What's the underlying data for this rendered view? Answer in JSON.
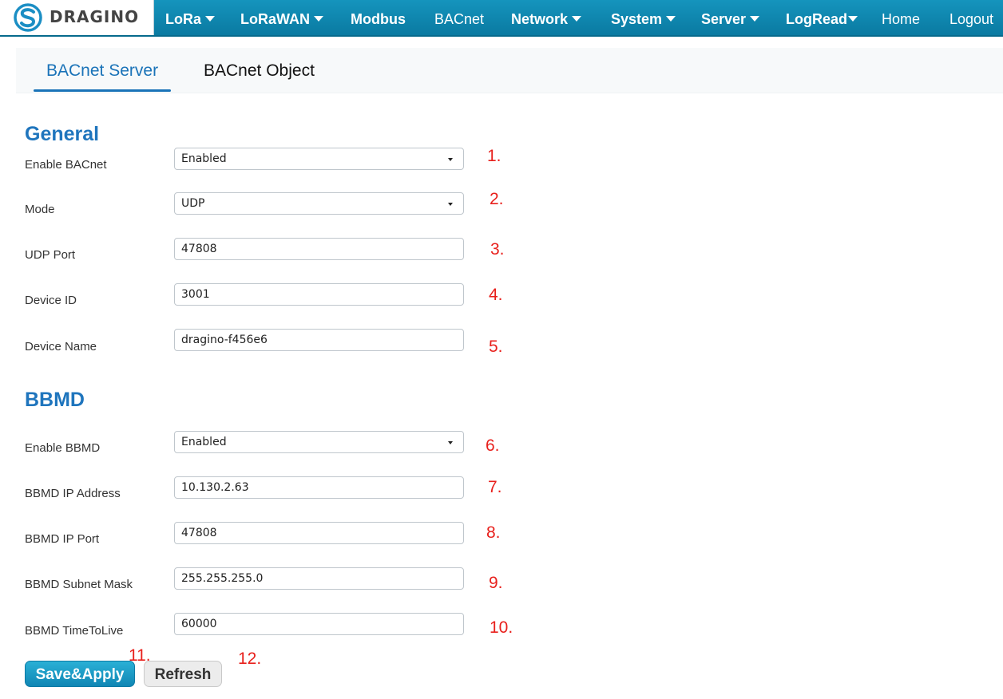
{
  "nav": {
    "logo_text": "DRAGINO",
    "items": [
      {
        "label": "LoRa",
        "dropdown": true
      },
      {
        "label": "LoRaWAN",
        "dropdown": true
      },
      {
        "label": "Modbus",
        "dropdown": false
      },
      {
        "label": "BACnet",
        "dropdown": false
      },
      {
        "label": "Network",
        "dropdown": true
      },
      {
        "label": "System",
        "dropdown": true
      },
      {
        "label": "Server",
        "dropdown": true
      },
      {
        "label": "LogRead",
        "dropdown": true
      },
      {
        "label": "Home",
        "dropdown": false
      },
      {
        "label": "Logout",
        "dropdown": false
      }
    ]
  },
  "tabs": [
    {
      "label": "BACnet Server",
      "active": true
    },
    {
      "label": "BACnet Object",
      "active": false
    }
  ],
  "general": {
    "title": "General",
    "fields": [
      {
        "label": "Enable BACnet",
        "value": "Enabled",
        "type": "select",
        "marker": "1."
      },
      {
        "label": "Mode",
        "value": "UDP",
        "type": "select",
        "marker": "2."
      },
      {
        "label": "UDP Port",
        "value": "47808",
        "type": "text",
        "marker": "3."
      },
      {
        "label": "Device ID",
        "value": "3001",
        "type": "text",
        "marker": "4."
      },
      {
        "label": "Device Name",
        "value": "dragino-f456e6",
        "type": "text",
        "marker": "5."
      }
    ]
  },
  "bbmd": {
    "title": "BBMD",
    "fields": [
      {
        "label": "Enable BBMD",
        "value": "Enabled",
        "type": "select",
        "marker": "6."
      },
      {
        "label": "BBMD IP Address",
        "value": "10.130.2.63",
        "type": "text",
        "marker": "7."
      },
      {
        "label": "BBMD IP Port",
        "value": "47808",
        "type": "text",
        "marker": "8."
      },
      {
        "label": "BBMD Subnet Mask",
        "value": "255.255.255.0",
        "type": "text",
        "marker": "9."
      },
      {
        "label": "BBMD TimeToLive",
        "value": "60000",
        "type": "text",
        "marker": "10."
      }
    ]
  },
  "actions": {
    "save_label": "Save&Apply",
    "save_marker": "11.",
    "refresh_label": "Refresh",
    "refresh_marker": "12."
  },
  "colors": {
    "nav_bg": "#0f87b0",
    "heading": "#1f75bd",
    "marker": "#e8201c"
  }
}
